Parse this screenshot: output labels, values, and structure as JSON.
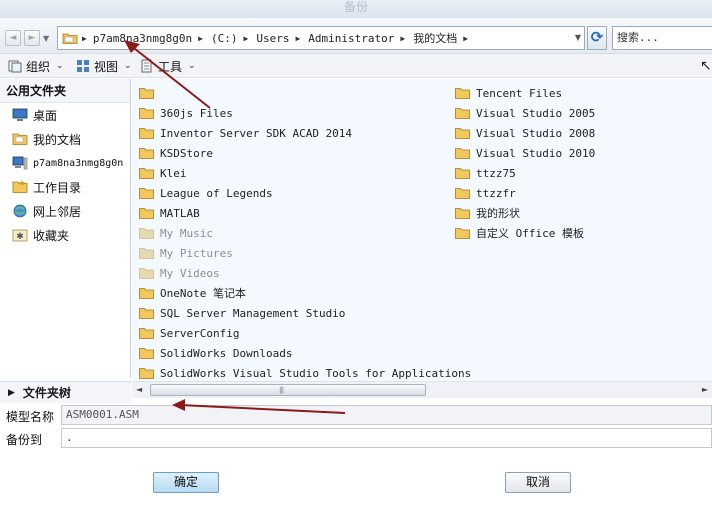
{
  "window": {
    "title": "备份"
  },
  "nav": {
    "back_glyph": "◄",
    "forward_glyph": "►",
    "breadcrumbs": [
      "p7am8na3nmg8g0n",
      "(C:)",
      "Users",
      "Administrator",
      "我的文档"
    ],
    "search_placeholder": "搜索..."
  },
  "toolbar": {
    "organize_label": "组织",
    "view_label": "视图",
    "tools_label": "工具"
  },
  "sidebar": {
    "header": "公用文件夹",
    "items": [
      {
        "label": "桌面",
        "icon": "desktop-icon"
      },
      {
        "label": "我的文档",
        "icon": "documents-icon"
      },
      {
        "label": "p7am8na3nmg8g0n",
        "icon": "computer-icon"
      },
      {
        "label": "工作目录",
        "icon": "working-directory-icon"
      },
      {
        "label": "网上邻居",
        "icon": "network-icon"
      },
      {
        "label": "收藏夹",
        "icon": "favorites-icon"
      }
    ],
    "tree_label": "文件夹树"
  },
  "files": {
    "column1": [
      {
        "name": "",
        "dim": false
      },
      {
        "name": "360js Files",
        "dim": false
      },
      {
        "name": "Inventor Server SDK ACAD 2014",
        "dim": false
      },
      {
        "name": "KSDStore",
        "dim": false
      },
      {
        "name": "Klei",
        "dim": false
      },
      {
        "name": "League of Legends",
        "dim": false
      },
      {
        "name": "MATLAB",
        "dim": false
      },
      {
        "name": "My Music",
        "dim": true
      },
      {
        "name": "My Pictures",
        "dim": true
      },
      {
        "name": "My Videos",
        "dim": true
      },
      {
        "name": "OneNote 笔记本",
        "dim": false
      },
      {
        "name": "SQL Server Management Studio",
        "dim": false
      },
      {
        "name": "ServerConfig",
        "dim": false
      },
      {
        "name": "SolidWorks Downloads",
        "dim": false
      },
      {
        "name": "SolidWorks Visual Studio Tools for Applications",
        "dim": false
      }
    ],
    "column2": [
      {
        "name": "Tencent Files",
        "dim": false
      },
      {
        "name": "Visual Studio 2005",
        "dim": false
      },
      {
        "name": "Visual Studio 2008",
        "dim": false
      },
      {
        "name": "Visual Studio 2010",
        "dim": false
      },
      {
        "name": "ttzz75",
        "dim": false
      },
      {
        "name": "ttzzfr",
        "dim": false
      },
      {
        "name": "我的形状",
        "dim": false
      },
      {
        "name": "自定义 Office 模板",
        "dim": false
      }
    ]
  },
  "form": {
    "model_name_label": "模型名称",
    "model_name_value": "ASM0001.ASM",
    "backup_to_label": "备份到",
    "backup_to_value": "."
  },
  "buttons": {
    "ok_label": "确定",
    "cancel_label": "取消"
  },
  "colors": {
    "folder": "#f2c75c",
    "folder_dim": "#e6d9b3",
    "annotation_arrow": "#8b1a1a",
    "ok_button": "#b7daf3"
  }
}
